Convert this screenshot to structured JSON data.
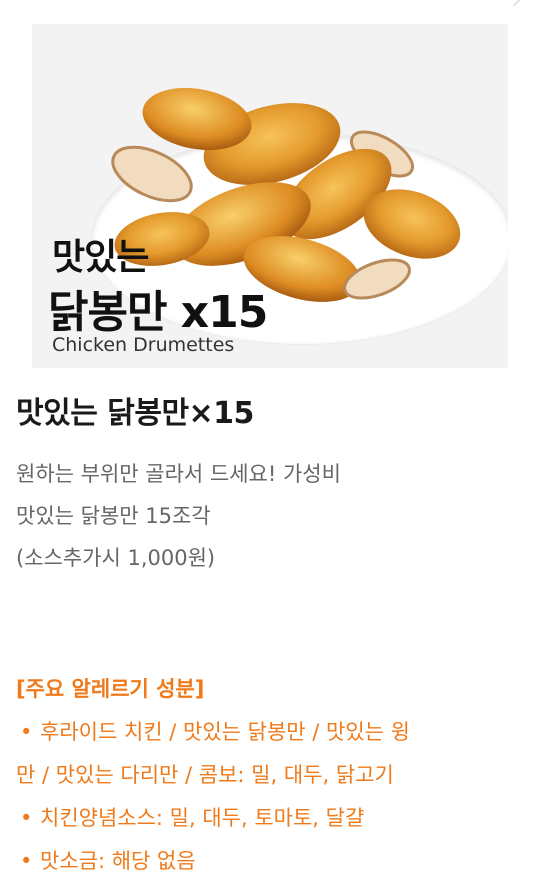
{
  "hero_image": {
    "overlay_line1": "맛있는",
    "overlay_line2": "닭봉만 x15",
    "overlay_line3": "Chicken Drumettes",
    "icon": "fried-chicken-drumettes-on-plate"
  },
  "product": {
    "title": "맛있는 닭봉만×15",
    "description_lines": [
      "원하는 부위만 골라서 드세요! 가성비",
      "맛있는 닭봉만 15조각",
      "(소스추가시 1,000원)"
    ]
  },
  "allergy": {
    "heading": "[주요 알레르기 성분]",
    "items": [
      "후라이드 치킨 / 맛있는 닭봉만 / 맛있는 윙",
      "만 / 맛있는 다리만 / 콤보: 밀, 대두, 닭고기",
      "치킨양념소스: 밀, 대두, 토마토, 달걀",
      "맛소금: 해당 없음"
    ],
    "color": "#f07a1a"
  }
}
